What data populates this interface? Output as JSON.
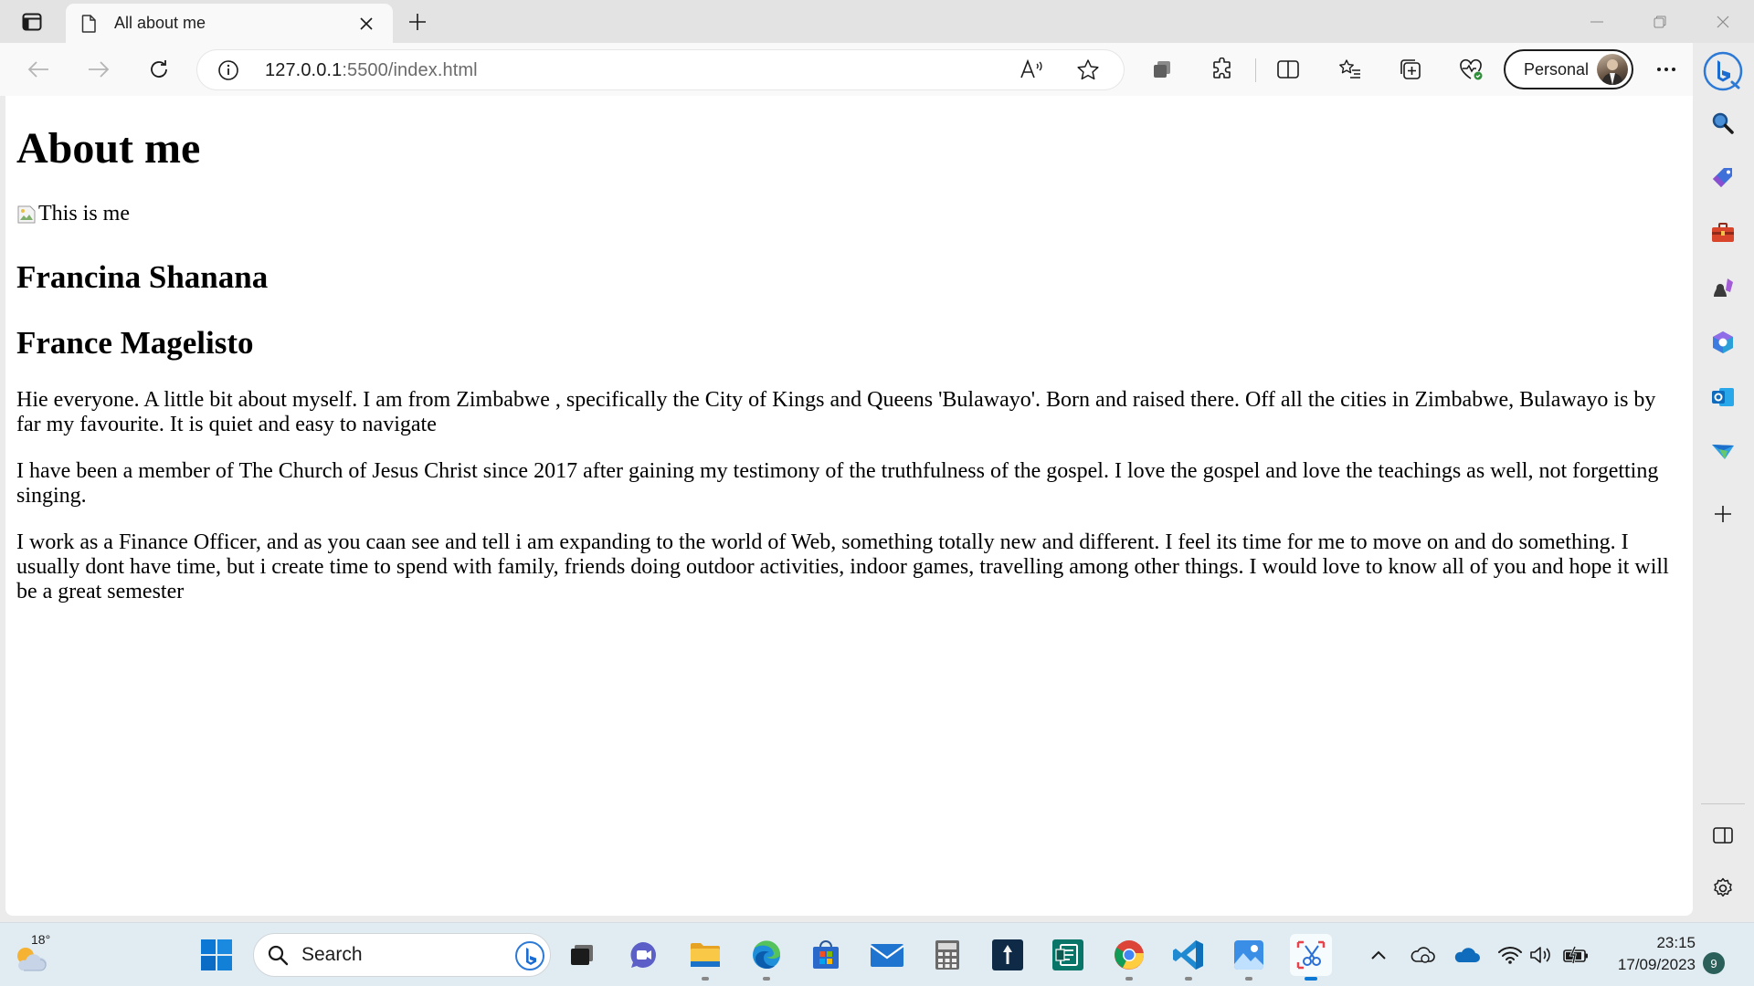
{
  "browser": {
    "tab": {
      "title": "All about me"
    },
    "address": {
      "host": "127.0.0.1",
      "rest": ":5500/index.html"
    },
    "profile": {
      "label": "Personal"
    }
  },
  "page": {
    "heading": "About me",
    "image_alt": "This is me",
    "name1": "Francina Shanana",
    "name2": "France Magelisto",
    "paragraphs": [
      "Hie everyone. A little bit about myself. I am from Zimbabwe , specifically the City of Kings and Queens 'Bulawayo'. Born and raised there. Off all the cities in Zimbabwe, Bulawayo is by far my favourite. It is quiet and easy to navigate",
      "I have been a member of The Church of Jesus Christ since 2017 after gaining my testimony of the truthfulness of the gospel. I love the gospel and love the teachings as well, not forgetting singing.",
      "I work as a Finance Officer, and as you caan see and tell i am expanding to the world of Web, something totally new and different. I feel its time for me to move on and do something. I usually dont have time, but i create time to spend with family, friends doing outdoor activities, indoor games, travelling among other things. I would love to know all of you and hope it will be a great semester"
    ]
  },
  "sidebar": {
    "icons": [
      "search-icon",
      "shopping-tag-icon",
      "tools-briefcase-icon",
      "games-icon",
      "microsoft-365-icon",
      "outlook-icon",
      "drop-icon",
      "add-icon",
      "split-panel-icon",
      "settings-icon"
    ]
  },
  "taskbar": {
    "weather_temp": "18°",
    "search_label": "Search",
    "time": "23:15",
    "date": "17/09/2023",
    "notification_count": "9"
  }
}
